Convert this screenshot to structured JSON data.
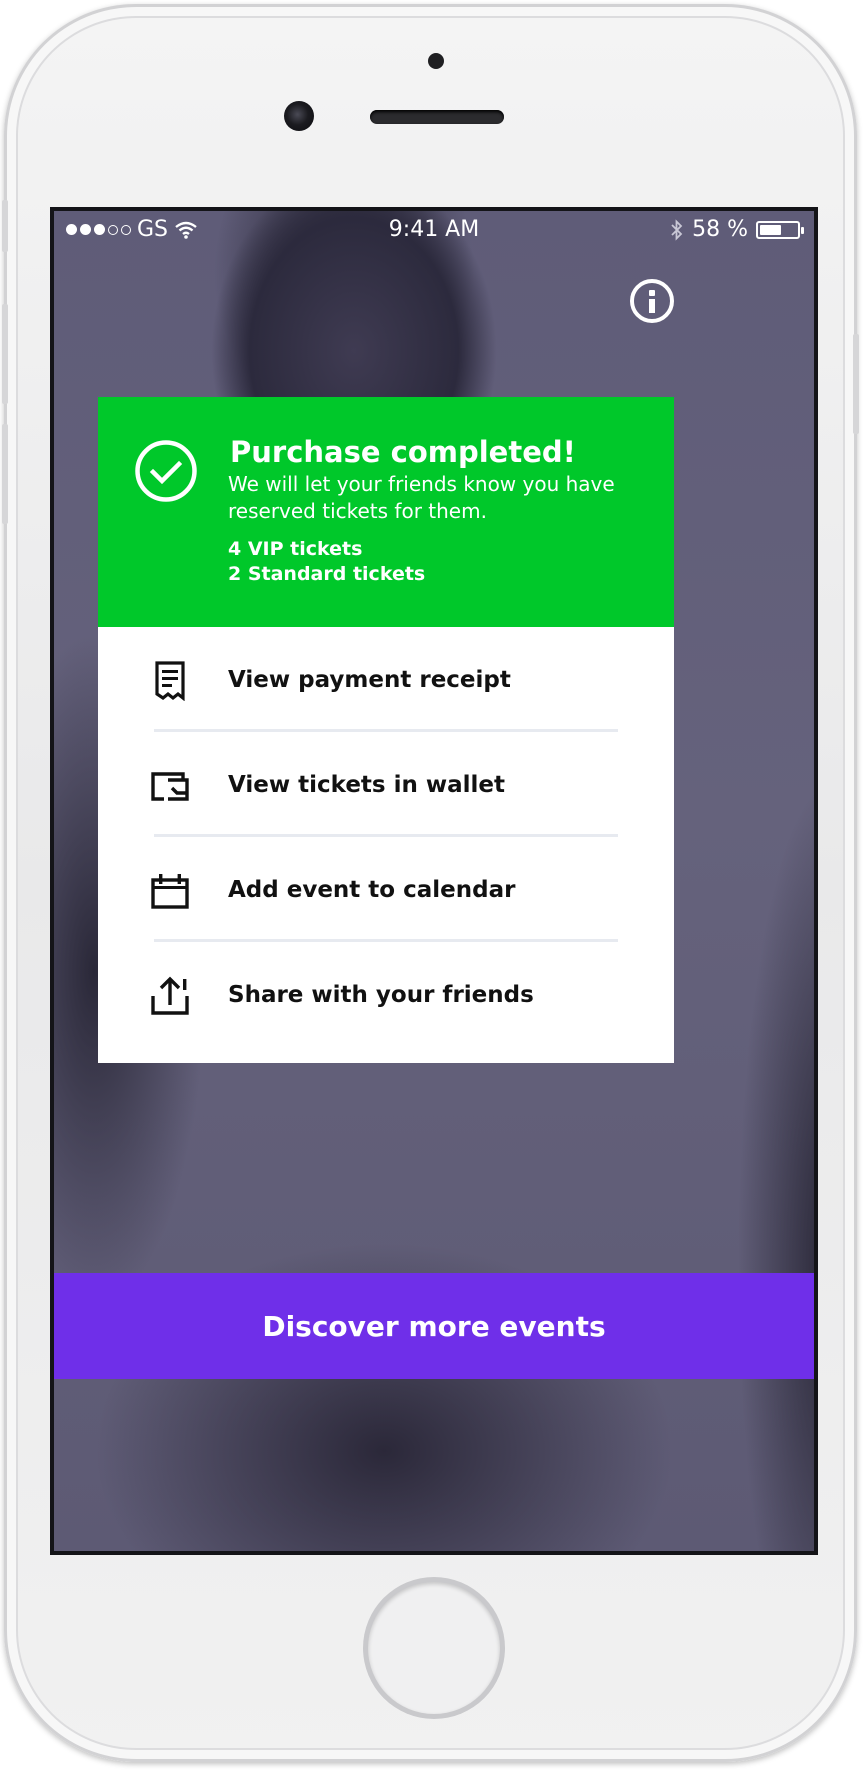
{
  "status_bar": {
    "carrier": "GS",
    "time": "9:41 AM",
    "battery_percent": "58 %",
    "battery_level": 0.58,
    "icons": [
      "signal-dots",
      "wifi-icon",
      "bluetooth-icon",
      "battery-icon"
    ]
  },
  "info_button": {
    "icon": "info-icon"
  },
  "confirmation": {
    "title": "Purchase completed!",
    "message": "We will let your friends know you have reserved tickets for them.",
    "tickets": [
      "4 VIP tickets",
      "2 Standard tickets"
    ],
    "icon": "checkmark-circle-icon",
    "color": "#00c82a"
  },
  "actions": [
    {
      "label": "View payment receipt",
      "icon": "receipt-icon"
    },
    {
      "label": "View tickets in wallet",
      "icon": "wallet-icon"
    },
    {
      "label": "Add event to calendar",
      "icon": "calendar-icon"
    },
    {
      "label": "Share with your friends",
      "icon": "share-icon"
    }
  ],
  "cta": {
    "label": "Discover more events",
    "color": "#6f2fe9"
  }
}
